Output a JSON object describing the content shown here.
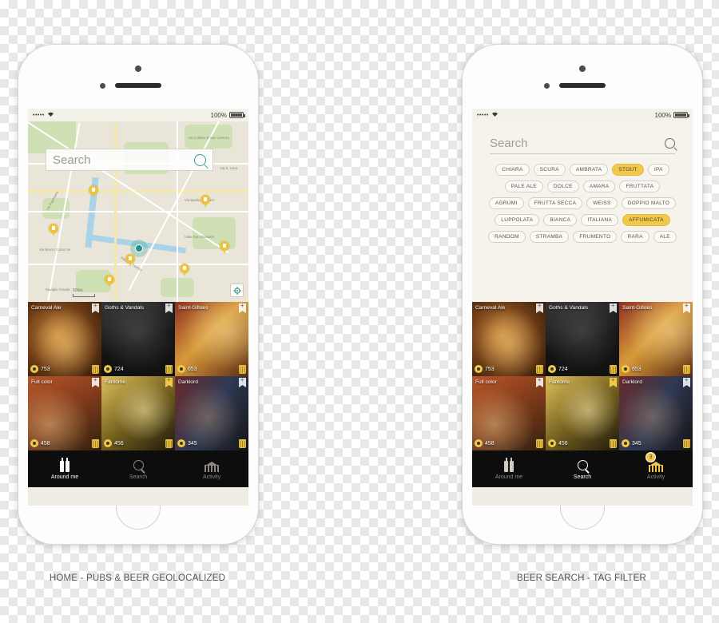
{
  "status_bar": {
    "signal": "•••••",
    "wifi_icon": "wifi-icon",
    "battery_pct": "100%"
  },
  "left_phone": {
    "caption": "HOME - PUBS & BEER GEOLOCALIZED",
    "map": {
      "search_placeholder": "Search",
      "search_icon": "search-icon",
      "scale_label": "500m",
      "locate_icon": "locate-me-icon",
      "street_labels": [
        "Via Colletta di San Lorenzo",
        "Via S. Luca",
        "Via Basilica di Sant'",
        "Viale Don Giovanni",
        "Via Papiniano",
        "Via Brera / Corso Ve",
        "Naviglio Pavese",
        "Naviglio Grande"
      ],
      "pin_count": 7
    },
    "tabs": [
      {
        "label": "Around me",
        "icon": "beer-bottles-icon",
        "active": true,
        "badge": ""
      },
      {
        "label": "Search",
        "icon": "search-icon",
        "active": false,
        "badge": ""
      },
      {
        "label": "Activity",
        "icon": "pub-building-icon",
        "active": false,
        "badge": ""
      }
    ]
  },
  "right_phone": {
    "caption": "BEER SEARCH - TAG FILTER",
    "search": {
      "placeholder": "Search",
      "value": "",
      "icon": "search-icon"
    },
    "tag_rows": [
      [
        {
          "label": "CHIARA",
          "active": false
        },
        {
          "label": "SCURA",
          "active": false
        },
        {
          "label": "AMBRATA",
          "active": false
        },
        {
          "label": "STOUT",
          "active": true
        },
        {
          "label": "IPA",
          "active": false
        }
      ],
      [
        {
          "label": "PALE ALE",
          "active": false
        },
        {
          "label": "DOLCE",
          "active": false
        },
        {
          "label": "AMARA",
          "active": false
        },
        {
          "label": "FRUTTATA",
          "active": false
        }
      ],
      [
        {
          "label": "AGRUMI",
          "active": false
        },
        {
          "label": "FRUTTA SECCA",
          "active": false
        },
        {
          "label": "WEISS",
          "active": false
        },
        {
          "label": "DOPPIO MALTO",
          "active": false
        }
      ],
      [
        {
          "label": "LUPPOLATA",
          "active": false
        },
        {
          "label": "BIANCA",
          "active": false
        },
        {
          "label": "ITALIANA",
          "active": false
        },
        {
          "label": "AFFUMICATA",
          "active": true
        }
      ],
      [
        {
          "label": "RANDOM",
          "active": false
        },
        {
          "label": "STRAMBA",
          "active": false
        },
        {
          "label": "FRUMENTO",
          "active": false
        },
        {
          "label": "RARA",
          "active": false
        },
        {
          "label": "ALE",
          "active": false
        }
      ]
    ],
    "tabs": [
      {
        "label": "Around me",
        "icon": "beer-bottles-icon",
        "active": false,
        "badge": ""
      },
      {
        "label": "Search",
        "icon": "search-icon",
        "active": true,
        "badge": ""
      },
      {
        "label": "Activity",
        "icon": "pub-building-icon",
        "active": false,
        "badge": "3"
      }
    ]
  },
  "beers": [
    {
      "title": "Carneval Ale",
      "count": "753",
      "bookmark": "white",
      "rate_icon": "rating-icon",
      "beer_icon": "beer-glass-icon"
    },
    {
      "title": "Goths & Vandals",
      "count": "724",
      "bookmark": "white",
      "rate_icon": "rating-icon",
      "beer_icon": "beer-glass-icon"
    },
    {
      "title": "Saint-Gilloes",
      "count": "653",
      "bookmark": "white",
      "rate_icon": "rating-icon",
      "beer_icon": "beer-glass-icon"
    },
    {
      "title": "Full color",
      "count": "458",
      "bookmark": "white",
      "rate_icon": "rating-icon",
      "beer_icon": "beer-glass-icon"
    },
    {
      "title": "Fantôme",
      "count": "456",
      "bookmark": "gold",
      "rate_icon": "rating-icon",
      "beer_icon": "beer-glass-icon"
    },
    {
      "title": "Darklord",
      "count": "345",
      "bookmark": "white",
      "rate_icon": "rating-icon",
      "beer_icon": "beer-glass-icon"
    }
  ],
  "colors": {
    "accent_gold": "#f1c94a",
    "tab_bar": "#0d0d0d",
    "map_green": "#cfe0b4",
    "map_water": "#a9d3e8",
    "teal": "#1d9488"
  }
}
